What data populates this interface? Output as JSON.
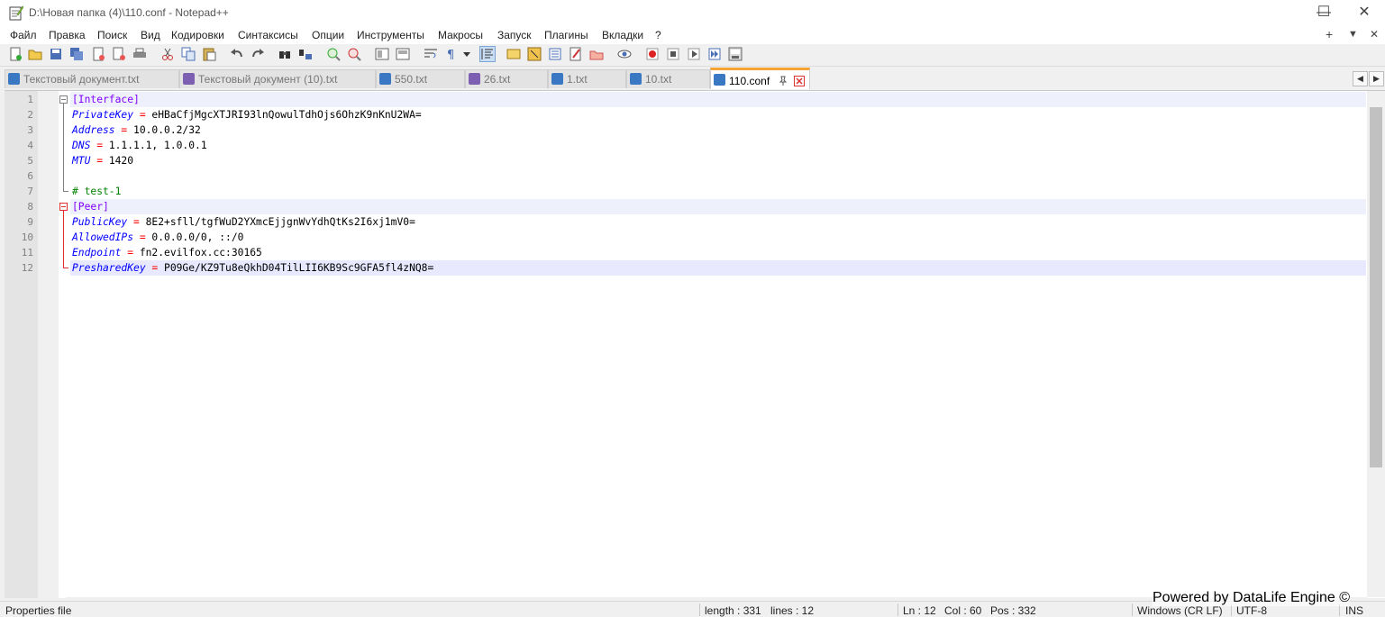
{
  "window": {
    "title": "D:\\Новая папка (4)\\110.conf - Notepad++",
    "controls": {
      "minimize": "—",
      "maximize": "☐",
      "close": "✕"
    }
  },
  "menu": {
    "items": [
      "Файл",
      "Правка",
      "Поиск",
      "Вид",
      "Кодировки",
      "Синтаксисы",
      "Опции",
      "Инструменты",
      "Макросы",
      "Запуск",
      "Плагины",
      "Вкладки",
      "?"
    ],
    "right": {
      "plus": "+",
      "dropdown": "▼",
      "close": "✕"
    }
  },
  "toolbar": {
    "icons": [
      "new-file-icon",
      "open-file-icon",
      "save-icon",
      "save-all-icon",
      "close-icon",
      "close-all-icon",
      "print-icon",
      "cut-icon",
      "copy-icon",
      "paste-icon",
      "undo-icon",
      "redo-icon",
      "find-icon",
      "replace-icon",
      "zoom-in-icon",
      "zoom-out-icon",
      "sync-vertical-icon",
      "sync-horizontal-icon",
      "word-wrap-icon",
      "show-all-chars-icon",
      "indent-guide-icon",
      "user-lang-icon",
      "doc-map-icon",
      "function-list-icon",
      "folder-workspace-icon",
      "monitoring-icon",
      "record-macro-icon",
      "stop-macro-icon",
      "play-macro-icon",
      "run-macro-multiple-icon",
      "save-macro-icon"
    ],
    "active_icon": "indent-guide-icon"
  },
  "tabs": [
    {
      "label": "Текстовый документ.txt",
      "icon_color": "#3b78c4",
      "active": false
    },
    {
      "label": "Текстовый документ (10).txt",
      "icon_color": "#7c5fb0",
      "active": false
    },
    {
      "label": "550.txt",
      "icon_color": "#3b78c4",
      "active": false
    },
    {
      "label": "26.txt",
      "icon_color": "#7c5fb0",
      "active": false
    },
    {
      "label": "1.txt",
      "icon_color": "#3b78c4",
      "active": false
    },
    {
      "label": "10.txt",
      "icon_color": "#3b78c4",
      "active": false
    },
    {
      "label": "110.conf",
      "icon_color": "#3b78c4",
      "active": true
    }
  ],
  "tab_scroll": {
    "left": "◀",
    "right": "▶"
  },
  "editor": {
    "lines": [
      {
        "num": "1",
        "section": "[Interface]"
      },
      {
        "num": "2",
        "key": "PrivateKey",
        "eq": " = ",
        "value": "eHBaCfjMgcXTJRI93lnQowulTdhOjs6OhzK9nKnU2WA="
      },
      {
        "num": "3",
        "key": "Address",
        "eq": " = ",
        "value": "10.0.0.2/32"
      },
      {
        "num": "4",
        "key": "DNS",
        "eq": " = ",
        "value": "1.1.1.1, 1.0.0.1"
      },
      {
        "num": "5",
        "key": "MTU",
        "eq": " = ",
        "value": "1420"
      },
      {
        "num": "6"
      },
      {
        "num": "7",
        "comment": "# test-1"
      },
      {
        "num": "8",
        "section": "[Peer]"
      },
      {
        "num": "9",
        "key": "PublicKey",
        "eq": " = ",
        "value": "8E2+sfll/tgfWuD2YXmcEjjgnWvYdhQtKs2I6xj1mV0="
      },
      {
        "num": "10",
        "key": "AllowedIPs",
        "eq": " = ",
        "value": "0.0.0.0/0, ::/0"
      },
      {
        "num": "11",
        "key": "Endpoint",
        "eq": " = ",
        "value": "fn2.evilfox.cc:30165"
      },
      {
        "num": "12",
        "key": "PresharedKey",
        "eq": " = ",
        "value": "P09Ge/KZ9Tu8eQkhD04TilLII6KB9Sc9GFA5fl4zNQ8="
      }
    ]
  },
  "status": {
    "file_type": "Properties file",
    "length": "length : 331",
    "lines": "lines : 12",
    "ln": "Ln : 12",
    "col": "Col : 60",
    "pos": "Pos : 332",
    "eol": "Windows (CR LF)",
    "encoding": "UTF-8",
    "mode": "INS"
  },
  "watermark": "Powered by DataLife Engine ©",
  "colors": {
    "section": "#8000ff",
    "key": "#0000ff",
    "operator": "#ff0000",
    "comment": "#008000",
    "active_tab_accent": "#f6a234",
    "current_line": "#e8e8ff"
  }
}
